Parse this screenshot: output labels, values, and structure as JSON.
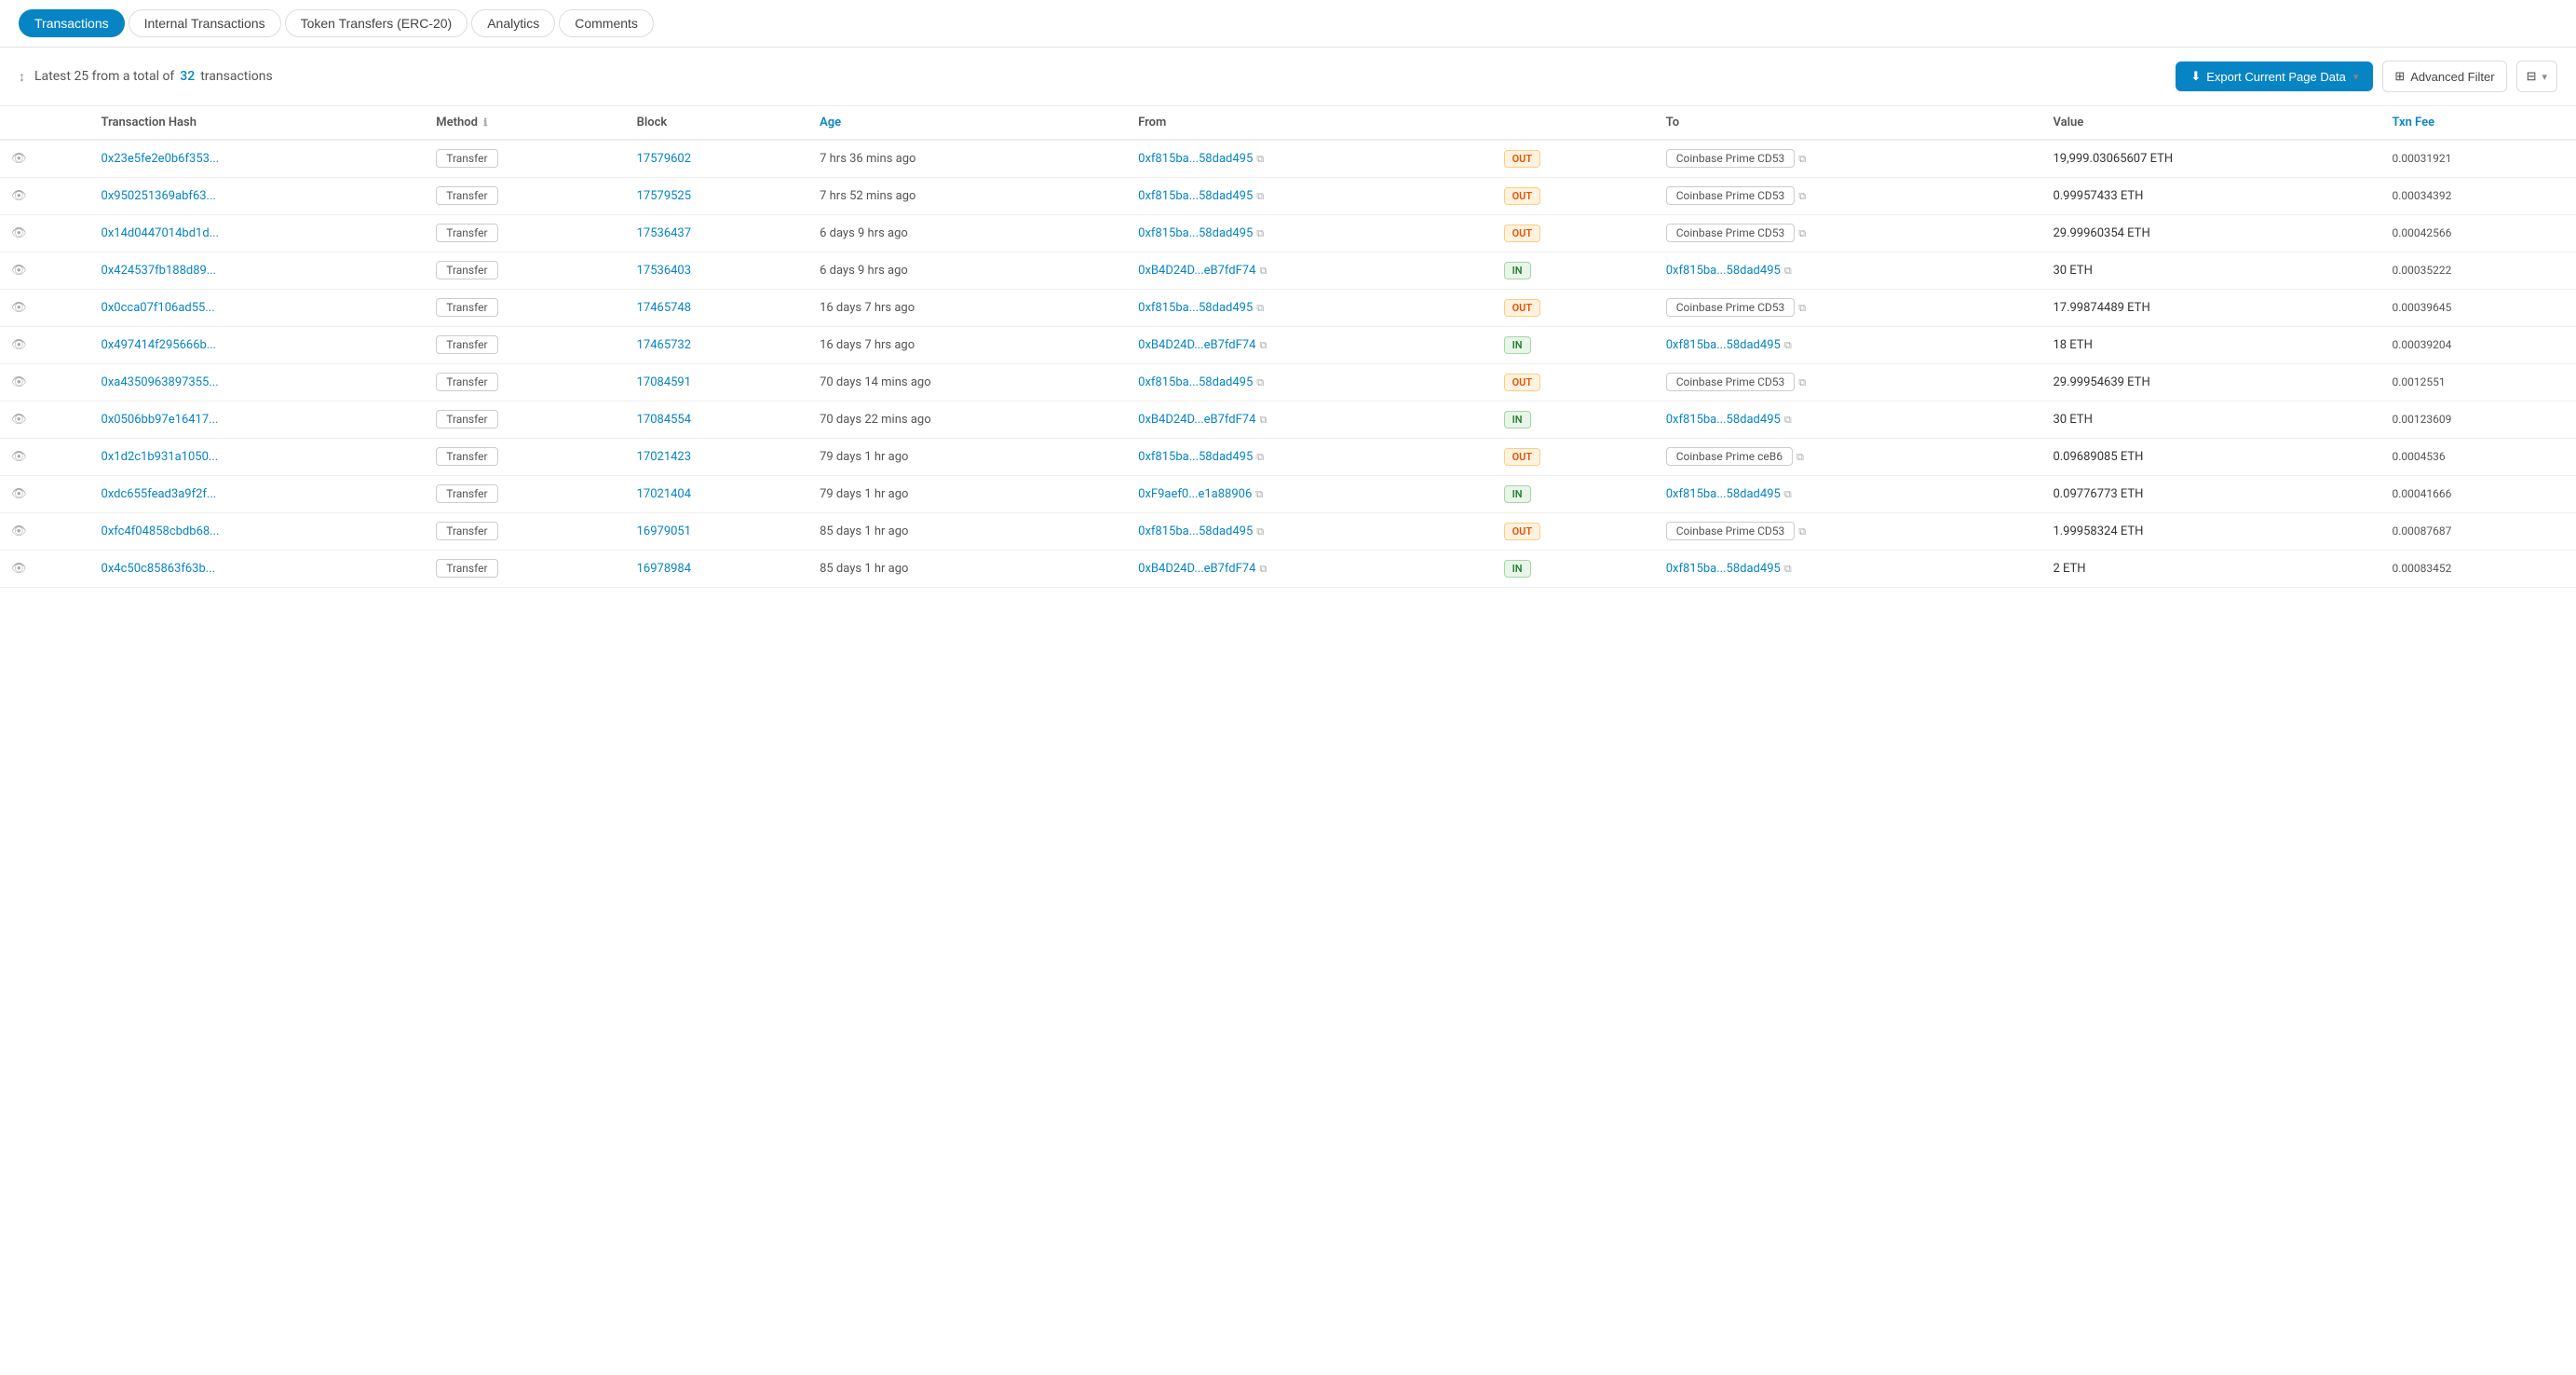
{
  "tabs": [
    {
      "id": "transactions",
      "label": "Transactions",
      "active": true
    },
    {
      "id": "internal-transactions",
      "label": "Internal Transactions",
      "active": false
    },
    {
      "id": "token-transfers",
      "label": "Token Transfers (ERC-20)",
      "active": false
    },
    {
      "id": "analytics",
      "label": "Analytics",
      "active": false
    },
    {
      "id": "comments",
      "label": "Comments",
      "active": false
    }
  ],
  "toolbar": {
    "summary": "Latest 25 from a total of",
    "count": "32",
    "unit": "transactions",
    "export_label": "Export Current Page Data",
    "advanced_filter_label": "Advanced Filter"
  },
  "table": {
    "columns": [
      {
        "id": "eye",
        "label": ""
      },
      {
        "id": "txhash",
        "label": "Transaction Hash"
      },
      {
        "id": "method",
        "label": "Method"
      },
      {
        "id": "block",
        "label": "Block"
      },
      {
        "id": "age",
        "label": "Age"
      },
      {
        "id": "from",
        "label": "From"
      },
      {
        "id": "direction",
        "label": ""
      },
      {
        "id": "to",
        "label": "To"
      },
      {
        "id": "value",
        "label": "Value"
      },
      {
        "id": "txnfee",
        "label": "Txn Fee"
      }
    ],
    "rows": [
      {
        "txhash": "0x23e5fe2e0b6f353...",
        "method": "Transfer",
        "block": "17579602",
        "age": "7 hrs 36 mins ago",
        "from": "0xf815ba...58dad495",
        "direction": "OUT",
        "to": "Coinbase Prime CD53",
        "to_is_label": true,
        "value": "19,999.03065607 ETH",
        "txnfee": "0.00031921"
      },
      {
        "txhash": "0x950251369abf63...",
        "method": "Transfer",
        "block": "17579525",
        "age": "7 hrs 52 mins ago",
        "from": "0xf815ba...58dad495",
        "direction": "OUT",
        "to": "Coinbase Prime CD53",
        "to_is_label": true,
        "value": "0.99957433 ETH",
        "txnfee": "0.00034392"
      },
      {
        "txhash": "0x14d0447014bd1d...",
        "method": "Transfer",
        "block": "17536437",
        "age": "6 days 9 hrs ago",
        "from": "0xf815ba...58dad495",
        "direction": "OUT",
        "to": "Coinbase Prime CD53",
        "to_is_label": true,
        "value": "29.99960354 ETH",
        "txnfee": "0.00042566"
      },
      {
        "txhash": "0x424537fb188d89...",
        "method": "Transfer",
        "block": "17536403",
        "age": "6 days 9 hrs ago",
        "from": "0xB4D24D...eB7fdF74",
        "from_is_link": true,
        "direction": "IN",
        "to": "0xf815ba...58dad495",
        "to_is_label": false,
        "value": "30 ETH",
        "txnfee": "0.00035222"
      },
      {
        "txhash": "0x0cca07f106ad55...",
        "method": "Transfer",
        "block": "17465748",
        "age": "16 days 7 hrs ago",
        "from": "0xf815ba...58dad495",
        "direction": "OUT",
        "to": "Coinbase Prime CD53",
        "to_is_label": true,
        "value": "17.99874489 ETH",
        "txnfee": "0.00039645"
      },
      {
        "txhash": "0x497414f295666b...",
        "method": "Transfer",
        "block": "17465732",
        "age": "16 days 7 hrs ago",
        "from": "0xB4D24D...eB7fdF74",
        "from_is_link": true,
        "direction": "IN",
        "to": "0xf815ba...58dad495",
        "to_is_label": false,
        "value": "18 ETH",
        "txnfee": "0.00039204"
      },
      {
        "txhash": "0xa4350963897355...",
        "method": "Transfer",
        "block": "17084591",
        "age": "70 days 14 mins ago",
        "from": "0xf815ba...58dad495",
        "direction": "OUT",
        "to": "Coinbase Prime CD53",
        "to_is_label": true,
        "value": "29.99954639 ETH",
        "txnfee": "0.0012551"
      },
      {
        "txhash": "0x0506bb97e16417...",
        "method": "Transfer",
        "block": "17084554",
        "age": "70 days 22 mins ago",
        "from": "0xB4D24D...eB7fdF74",
        "from_is_link": true,
        "direction": "IN",
        "to": "0xf815ba...58dad495",
        "to_is_label": false,
        "value": "30 ETH",
        "txnfee": "0.00123609"
      },
      {
        "txhash": "0x1d2c1b931a1050...",
        "method": "Transfer",
        "block": "17021423",
        "age": "79 days 1 hr ago",
        "from": "0xf815ba...58dad495",
        "direction": "OUT",
        "to": "Coinbase Prime ceB6",
        "to_is_label": true,
        "value": "0.09689085 ETH",
        "txnfee": "0.0004536"
      },
      {
        "txhash": "0xdc655fead3a9f2f...",
        "method": "Transfer",
        "block": "17021404",
        "age": "79 days 1 hr ago",
        "from": "0xF9aef0...e1a88906",
        "from_is_link": true,
        "direction": "IN",
        "to": "0xf815ba...58dad495",
        "to_is_label": false,
        "value": "0.09776773 ETH",
        "txnfee": "0.00041666"
      },
      {
        "txhash": "0xfc4f04858cbdb68...",
        "method": "Transfer",
        "block": "16979051",
        "age": "85 days 1 hr ago",
        "from": "0xf815ba...58dad495",
        "direction": "OUT",
        "to": "Coinbase Prime CD53",
        "to_is_label": true,
        "value": "1.99958324 ETH",
        "txnfee": "0.00087687"
      },
      {
        "txhash": "0x4c50c85863f63b...",
        "method": "Transfer",
        "block": "16978984",
        "age": "85 days 1 hr ago",
        "from": "0xB4D24D...eB7fdF74",
        "from_is_link": true,
        "direction": "IN",
        "to": "0xf815ba...58dad495",
        "to_is_label": false,
        "value": "2 ETH",
        "txnfee": "0.00083452"
      }
    ]
  }
}
